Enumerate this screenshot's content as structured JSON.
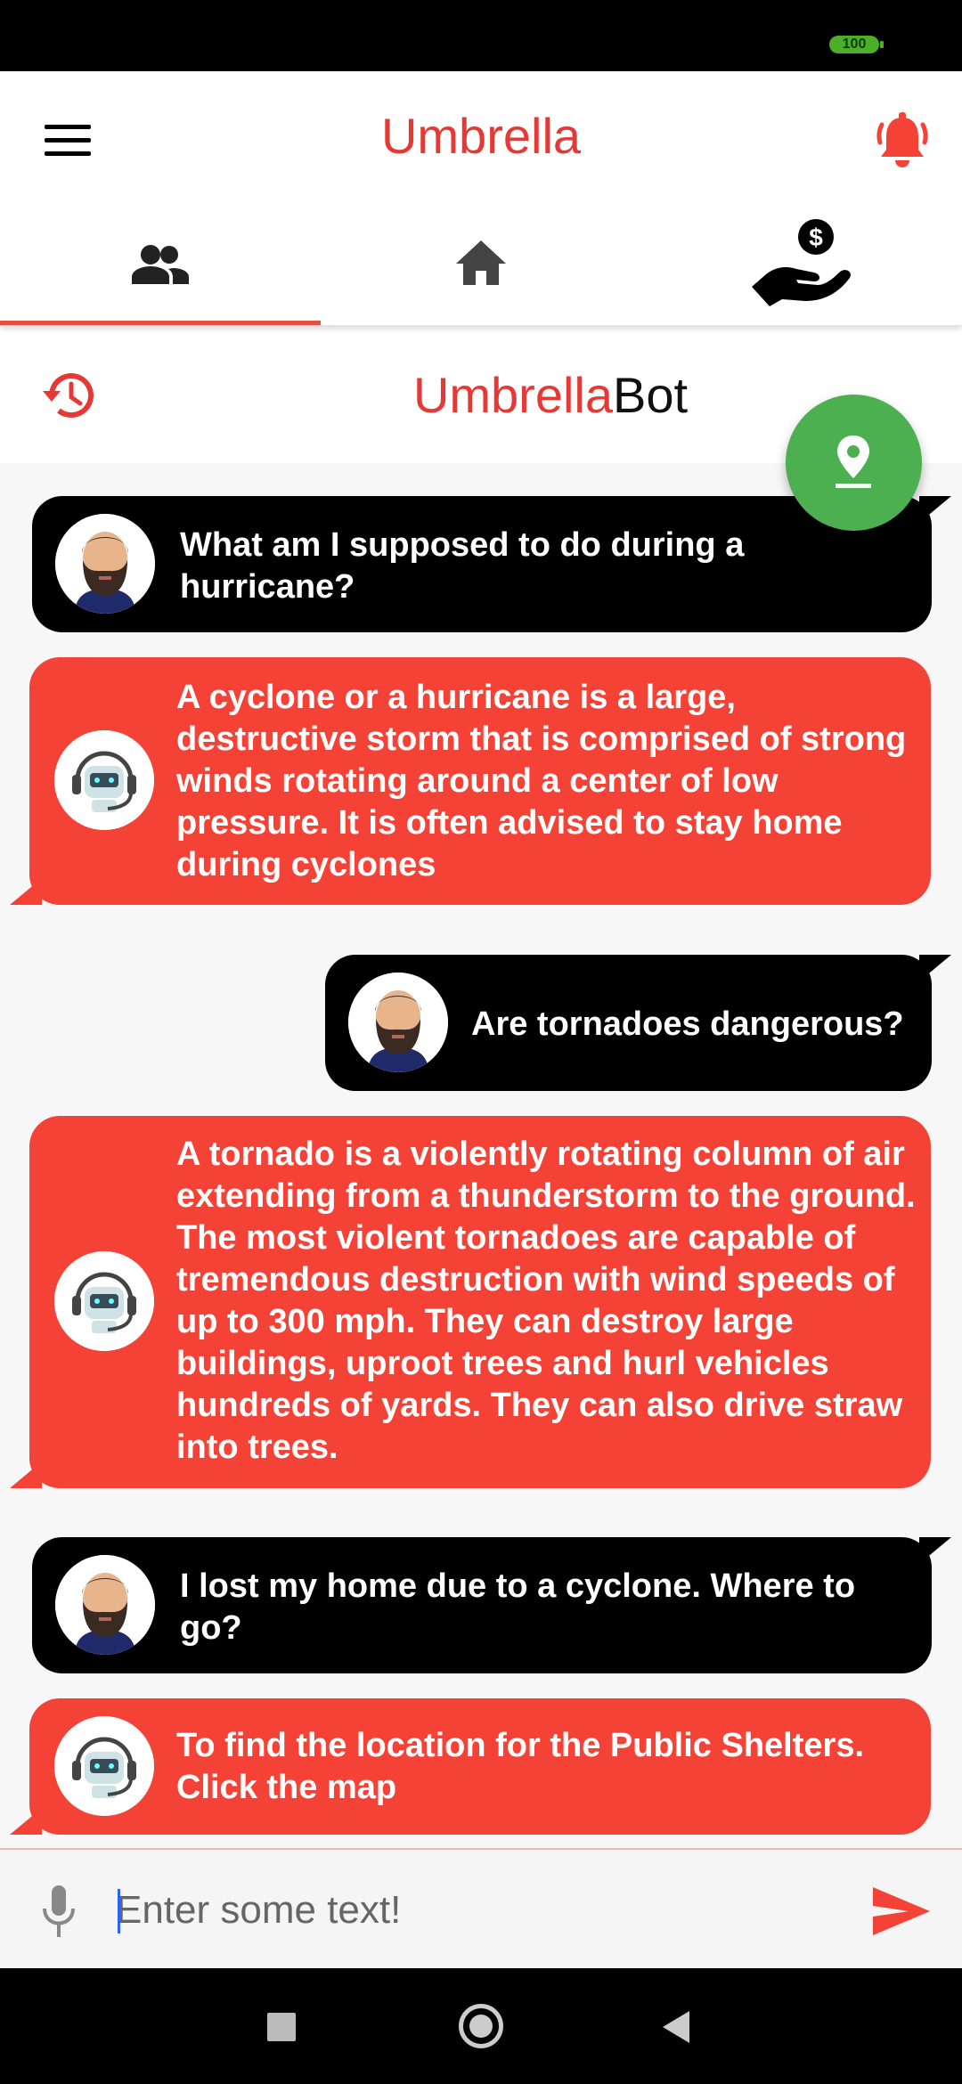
{
  "status_bar": {
    "battery": "100"
  },
  "app_bar": {
    "title": "Umbrella",
    "menu_icon": "menu-icon",
    "notification_icon": "bell-icon"
  },
  "tabs": [
    {
      "icon": "people-icon",
      "selected": true
    },
    {
      "icon": "home-icon",
      "selected": false
    },
    {
      "icon": "donate-hand-icon",
      "selected": false
    }
  ],
  "bot_header": {
    "title_prefix": "Umbrella",
    "title_suffix": "Bot",
    "history_icon": "history-icon"
  },
  "fab": {
    "icon": "location-pin-icon",
    "color": "#4caf50"
  },
  "colors": {
    "accent": "#e53935",
    "bot_bubble": "#f44336",
    "user_bubble": "#000000"
  },
  "messages": [
    {
      "sender": "user",
      "text": "What am I supposed to do during a hurricane?"
    },
    {
      "sender": "bot",
      "text": "A cyclone or a hurricane is a large, destructive storm that is comprised of strong winds rotating around a center of low pressure. It is often advised to stay home during cyclones"
    },
    {
      "sender": "user",
      "text": "Are tornadoes dangerous?"
    },
    {
      "sender": "bot",
      "text": "A tornado is a violently rotating column of air extending from a thunderstorm to the ground. The most violent tornadoes are capable of tremendous destruction with wind speeds of up to 300 mph. They can destroy large buildings, uproot trees and hurl vehicles hundreds of yards. They can also drive straw into trees."
    },
    {
      "sender": "user",
      "text": "I lost my home due to a cyclone. Where to go?"
    },
    {
      "sender": "bot",
      "text": "To find the location for the Public Shelters. Click the map"
    }
  ],
  "input": {
    "placeholder": "Enter some text!",
    "value": "",
    "mic_icon": "mic-icon",
    "send_icon": "send-icon"
  }
}
